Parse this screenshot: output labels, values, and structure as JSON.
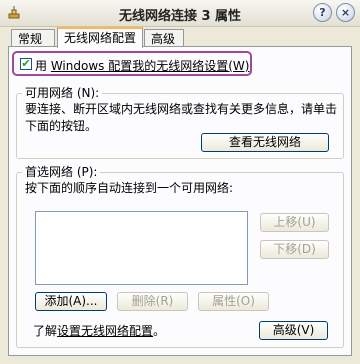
{
  "window": {
    "title": "无线网络连接 3 属性"
  },
  "title_buttons": {
    "help": "?",
    "close": "×"
  },
  "tabs": [
    {
      "label": "常规"
    },
    {
      "label": "无线网络配置"
    },
    {
      "label": "高级"
    }
  ],
  "use_windows": {
    "label_prefix": "用 ",
    "label_underlined": "Windows 配置我的无线网络设置(W)",
    "checked": true,
    "check_mark": "✔"
  },
  "available": {
    "legend": "可用网络 (N):",
    "description": "要连接、断开区域内无线网络或查找有关更多信息，请单击下面的按钮。",
    "view_button": "查看无线网络"
  },
  "preferred": {
    "legend": "首选网络 (P):",
    "description": "按下面的顺序自动连接到一个可用网络:",
    "move_up": "上移(U)",
    "move_down": "下移(D)",
    "add": "添加(A)...",
    "remove": "删除(R)",
    "properties": "属性(O)"
  },
  "footer": {
    "learn_prefix": "了解",
    "learn_link": "设置无线网络配置",
    "learn_suffix": "。",
    "advanced_button": "高级(V)"
  },
  "colors": {
    "window_bg": "#ece9d8",
    "panel_bg": "#fcfcfe",
    "highlight_border": "#a0489c",
    "active_tab_accent": "#ffb64f"
  }
}
